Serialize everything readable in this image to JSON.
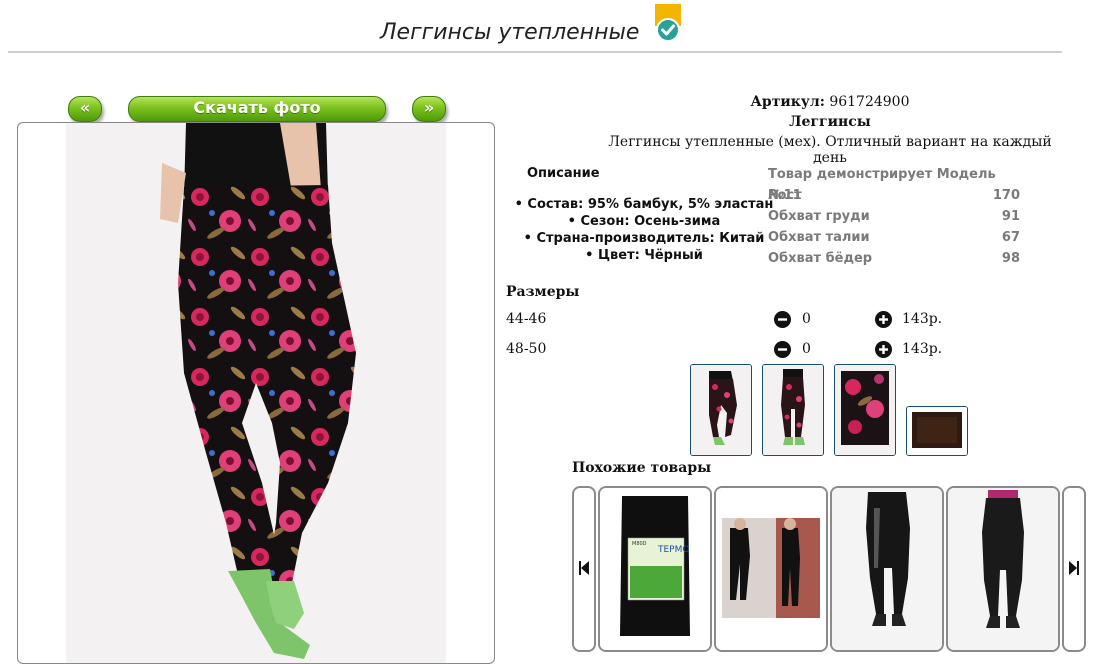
{
  "page": {
    "title": "Леггинсы утепленные",
    "verified_badge": "check-badge-icon"
  },
  "gallery": {
    "prev_label": "«",
    "download_label": "Скачать фото",
    "next_label": "»"
  },
  "product": {
    "article_label": "Артикул:",
    "article_value": "961724900",
    "category": "Леггинсы",
    "short_description": "Леггинсы утепленные (мех). Отличный вариант на каждый день"
  },
  "description": {
    "heading": "Описание",
    "items": [
      "Состав: 95% бамбук, 5% эластан",
      "Сезон: Осень-зима",
      "Страна-производитель: Китай",
      "Цвет: Чёрный"
    ]
  },
  "model": {
    "heading": "Товар демонстрирует Модель №11",
    "rows": [
      {
        "label": "Рост",
        "value": "170"
      },
      {
        "label": "Обхват груди",
        "value": "91"
      },
      {
        "label": "Обхват талии",
        "value": "67"
      },
      {
        "label": "Обхват бёдер",
        "value": "98"
      }
    ]
  },
  "sizes": {
    "heading": "Размеры",
    "rows": [
      {
        "size": "44-46",
        "qty": "0",
        "price": "143р."
      },
      {
        "size": "48-50",
        "qty": "0",
        "price": "143р."
      }
    ]
  },
  "similar": {
    "heading": "Похожие товары",
    "package_brand": "ТЕРМО",
    "package_code": "M80D"
  },
  "colors": {
    "green_button": "#7cc11d",
    "thumb_border": "#16506e",
    "model_text": "#7a7a7a",
    "badge_yellow": "#f4b400",
    "badge_teal": "#2aa198"
  }
}
